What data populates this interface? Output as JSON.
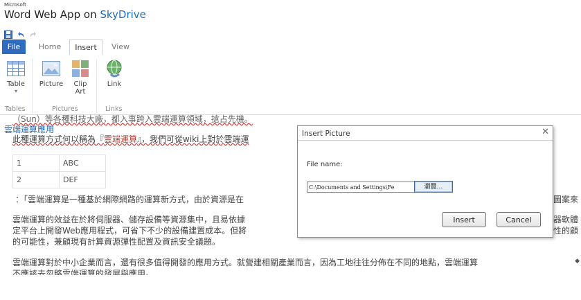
{
  "app": {
    "vendor": "Microsoft",
    "name": "Word Web App",
    "document": "雲端運算應用",
    "on": "on",
    "service": "SkyDrive"
  },
  "quick_access": [
    "save-icon",
    "undo-icon",
    "redo-icon"
  ],
  "tabs": {
    "file": "File",
    "home": "Home",
    "insert": "Insert",
    "view": "View"
  },
  "ribbon": {
    "table": "Table",
    "table_arrow": "▾",
    "picture": "Picture",
    "clipart_1": "Clip",
    "clipart_2": "Art",
    "link": "Link",
    "group_tables": "Tables",
    "group_pictures": "Pictures",
    "group_links": "Links"
  },
  "document": {
    "line0": "（Sun）等各種科技大廠，都入事跨入雲端運算領域，搶占先機。",
    "line1_a": "此種運算方式何以稱為『",
    "line1_b": "雲端運算",
    "line1_c": "』，我們可從wiki上對於雲端運",
    "table": [
      [
        "1",
        "ABC"
      ],
      [
        "2",
        "DEF"
      ]
    ],
    "line2_a": "：「雲端運算是一種基於網際網路的運算新方式，由於資源是在",
    "line2_b": "圖案來",
    "line3_a": "雲端運算的效益在於將伺服器、儲存設備等資源集中，且易依據",
    "line3_b": "器軟體",
    "line4_a": "定平台上開發Web應用程式，可省下不少的設備建置成本。但將",
    "line4_b": "性的顧",
    "line5": "的可能性，兼顧現有計算資源彈性配置及資訊安全議題。",
    "line6": "雲端運算對於中小企業而言，還有很多值得開發的應用方式。就營建相關產業而言，因為工地往往分佈在不同的地點，雲端運算",
    "line7": "不應該去忽略雲端運算的發展與應用。"
  },
  "dialog": {
    "title": "Insert Picture",
    "close": "✕",
    "file_label": "File name:",
    "file_value": "C:\\Documents and Settings\\Fe",
    "browse": "瀏覽…",
    "insert": "Insert",
    "cancel": "Cancel"
  },
  "colors": {
    "file_tab": "#2f6bbf",
    "link": "#1e6bb8",
    "spell_error": "#d04040"
  }
}
